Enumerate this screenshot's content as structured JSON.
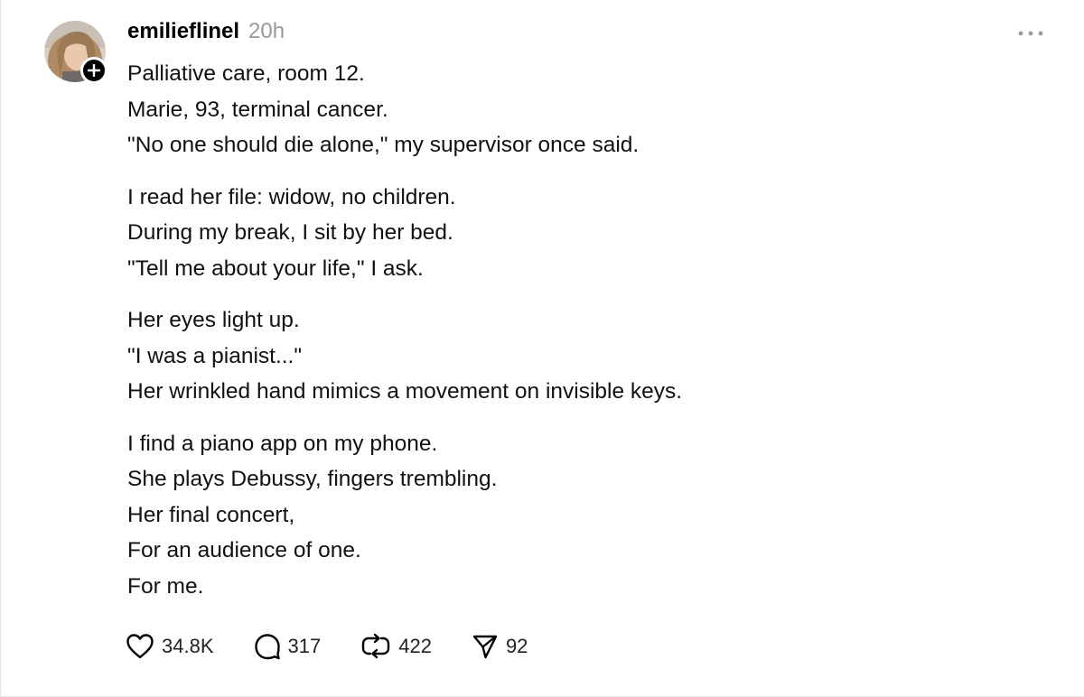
{
  "post": {
    "username": "emilieflinel",
    "timestamp": "20h",
    "paragraphs": [
      [
        "Palliative care, room 12.",
        "Marie, 93, terminal cancer.",
        "\"No one should die alone,\" my supervisor once said."
      ],
      [
        "I read her file: widow, no children.",
        "During my break, I sit by her bed.",
        "\"Tell me about your life,\" I ask."
      ],
      [
        "Her eyes light up.",
        "\"I was a pianist...\"",
        "Her wrinkled hand mimics a movement on invisible keys."
      ],
      [
        "I find a piano app on my phone.",
        "She plays Debussy, fingers trembling.",
        "Her final concert,",
        "For an audience of one.",
        "For me."
      ]
    ],
    "actions": {
      "likes": "34.8K",
      "comments": "317",
      "reposts": "422",
      "shares": "92"
    },
    "icons": {
      "avatar": "avatar-photo",
      "follow": "plus-icon",
      "more": "more-dots-icon",
      "like": "heart-icon",
      "comment": "comment-bubble-icon",
      "repost": "repost-icon",
      "share": "send-icon"
    }
  }
}
